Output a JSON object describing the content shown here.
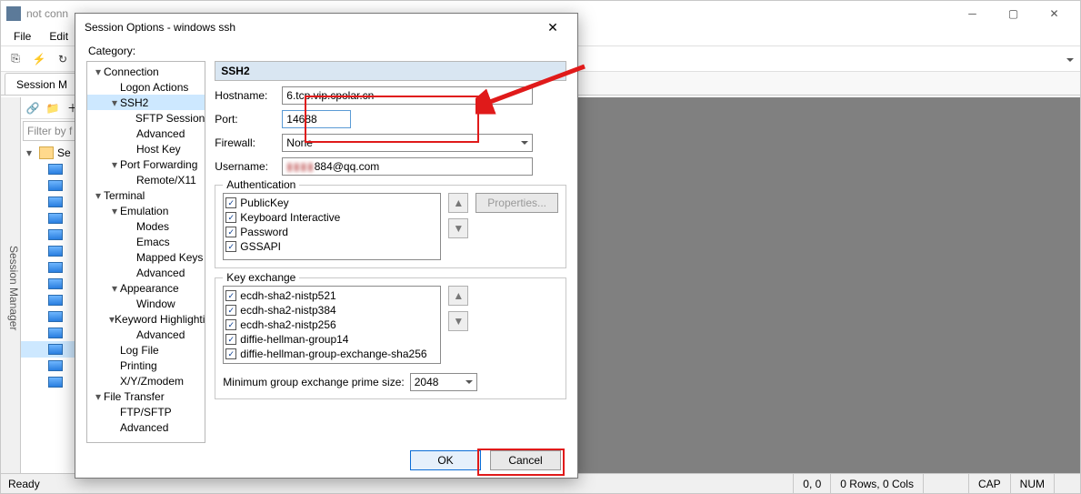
{
  "window": {
    "title": "not conn",
    "menus": [
      "File",
      "Edit"
    ],
    "tab": "Session M",
    "status": {
      "ready": "Ready",
      "pos": "0, 0",
      "rc": "0 Rows, 0 Cols",
      "cap": "CAP",
      "num": "NUM"
    }
  },
  "side": {
    "filter_placeholder": "Filter by f",
    "root": "Se",
    "rail": "Session Manager",
    "items": [
      "",
      "",
      "",
      "",
      "",
      "",
      "",
      "",
      "",
      "",
      "",
      "",
      "",
      ""
    ]
  },
  "dialog": {
    "title": "Session Options - windows ssh",
    "category_label": "Category:",
    "tree": [
      {
        "l": 0,
        "c": "▾",
        "t": "Connection"
      },
      {
        "l": 1,
        "c": "",
        "t": "Logon Actions"
      },
      {
        "l": 1,
        "c": "▾",
        "t": "SSH2",
        "sel": true
      },
      {
        "l": 2,
        "c": "",
        "t": "SFTP Session"
      },
      {
        "l": 2,
        "c": "",
        "t": "Advanced"
      },
      {
        "l": 2,
        "c": "",
        "t": "Host Key"
      },
      {
        "l": 1,
        "c": "▾",
        "t": "Port Forwarding"
      },
      {
        "l": 2,
        "c": "",
        "t": "Remote/X11"
      },
      {
        "l": 0,
        "c": "▾",
        "t": "Terminal"
      },
      {
        "l": 1,
        "c": "▾",
        "t": "Emulation"
      },
      {
        "l": 2,
        "c": "",
        "t": "Modes"
      },
      {
        "l": 2,
        "c": "",
        "t": "Emacs"
      },
      {
        "l": 2,
        "c": "",
        "t": "Mapped Keys"
      },
      {
        "l": 2,
        "c": "",
        "t": "Advanced"
      },
      {
        "l": 1,
        "c": "▾",
        "t": "Appearance"
      },
      {
        "l": 2,
        "c": "",
        "t": "Window"
      },
      {
        "l": 1,
        "c": "▾",
        "t": "Keyword Highlighting"
      },
      {
        "l": 2,
        "c": "",
        "t": "Advanced"
      },
      {
        "l": 1,
        "c": "",
        "t": "Log File"
      },
      {
        "l": 1,
        "c": "",
        "t": "Printing"
      },
      {
        "l": 1,
        "c": "",
        "t": "X/Y/Zmodem"
      },
      {
        "l": 0,
        "c": "▾",
        "t": "File Transfer"
      },
      {
        "l": 1,
        "c": "",
        "t": "FTP/SFTP"
      },
      {
        "l": 1,
        "c": "",
        "t": "Advanced"
      }
    ],
    "section": "SSH2",
    "labels": {
      "hostname": "Hostname:",
      "port": "Port:",
      "firewall": "Firewall:",
      "username": "Username:",
      "auth": "Authentication",
      "kex": "Key exchange",
      "min_prime": "Minimum group exchange prime size:",
      "properties": "Properties...",
      "ok": "OK",
      "cancel": "Cancel"
    },
    "values": {
      "hostname": "6.tcp.vip.cpolar.cn",
      "port": "14688",
      "firewall": "None",
      "username_suffix": "884@qq.com",
      "min_prime": "2048"
    },
    "auth": [
      "PublicKey",
      "Keyboard Interactive",
      "Password",
      "GSSAPI"
    ],
    "kex": [
      "ecdh-sha2-nistp521",
      "ecdh-sha2-nistp384",
      "ecdh-sha2-nistp256",
      "diffie-hellman-group14",
      "diffie-hellman-group-exchange-sha256"
    ]
  }
}
